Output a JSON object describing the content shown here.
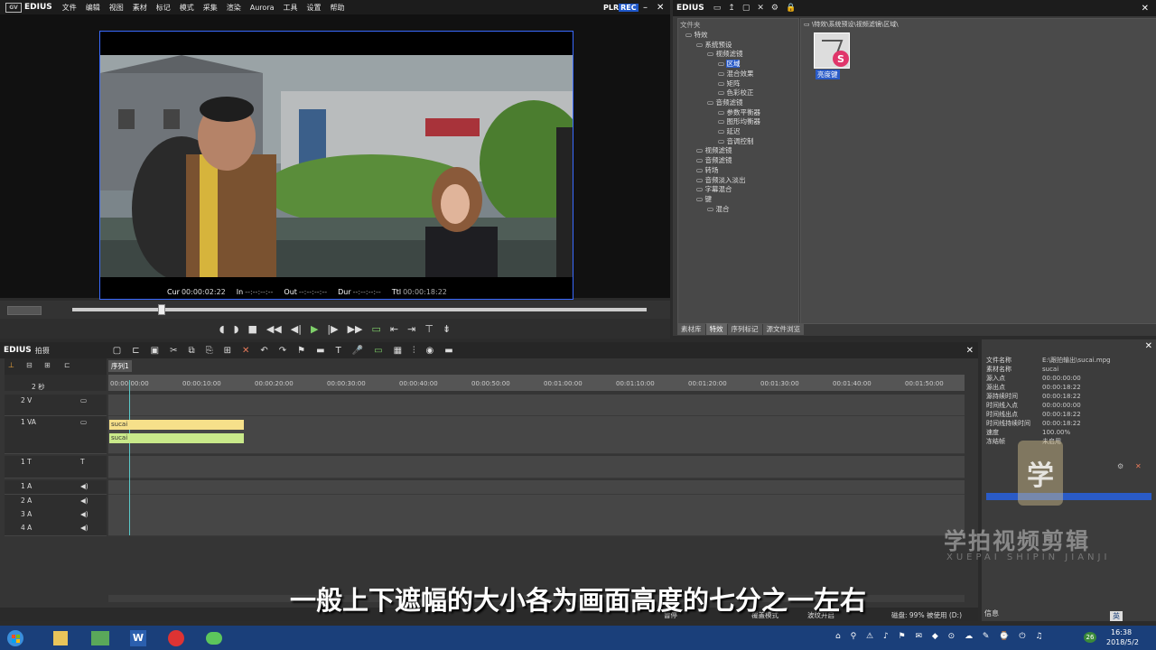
{
  "app": {
    "name": "EDIUS",
    "menus": [
      "文件",
      "编辑",
      "视图",
      "素材",
      "标记",
      "模式",
      "采集",
      "渲染",
      "Aurora",
      "工具",
      "设置",
      "帮助"
    ],
    "plr": "PLR",
    "rec": "REC"
  },
  "preview": {
    "cur_label": "Cur",
    "cur_value": "00:00:02:22",
    "in_label": "In",
    "in_value": "--:--:--:--",
    "out_label": "Out",
    "out_value": "--:--:--:--",
    "dur_label": "Dur",
    "dur_value": "--:--:--:--",
    "ttl_label": "Ttl",
    "ttl_value": "00:00:18:22"
  },
  "effects_panel": {
    "title": "EDIUS",
    "tree_header": "文件夹",
    "path": "\\特效\\系统预设\\视频滤镜\\区域\\",
    "tree": [
      {
        "label": "特效",
        "level": 0
      },
      {
        "label": "系统预设",
        "level": 1
      },
      {
        "label": "视频滤镜",
        "level": 2
      },
      {
        "label": "区域",
        "level": 3,
        "selected": true
      },
      {
        "label": "混合效果",
        "level": 3
      },
      {
        "label": "矩阵",
        "level": 3
      },
      {
        "label": "色彩校正",
        "level": 3
      },
      {
        "label": "音频滤镜",
        "level": 2
      },
      {
        "label": "参数平衡器",
        "level": 3
      },
      {
        "label": "图形均衡器",
        "level": 3
      },
      {
        "label": "延迟",
        "level": 3
      },
      {
        "label": "音调控制",
        "level": 3
      },
      {
        "label": "视频滤镜",
        "level": 1
      },
      {
        "label": "音频滤镜",
        "level": 1
      },
      {
        "label": "转场",
        "level": 1
      },
      {
        "label": "音频淡入淡出",
        "level": 1
      },
      {
        "label": "字幕混合",
        "level": 1
      },
      {
        "label": "键",
        "level": 1
      },
      {
        "label": "混合",
        "level": 2
      }
    ],
    "thumb_label": "亮度键",
    "tabs": [
      "素材库",
      "特效",
      "序列标记",
      "源文件浏览"
    ],
    "active_tab": "特效"
  },
  "timeline": {
    "title": "EDIUS",
    "project": "拍摄",
    "sequence_tab": "序列1",
    "zoom_label": "2 秒",
    "ruler_labels": [
      "00:00:00:00",
      "00:00:10:00",
      "00:00:20:00",
      "00:00:30:00",
      "00:00:40:00",
      "00:00:50:00",
      "00:01:00:00",
      "00:01:10:00",
      "00:01:20:00",
      "00:01:30:00",
      "00:01:40:00",
      "00:01:50:00"
    ],
    "tracks": [
      {
        "name": "2 V",
        "type": "video"
      },
      {
        "name": "1 VA",
        "type": "videoaudio"
      },
      {
        "name": "1 T",
        "type": "title"
      },
      {
        "name": "1 A",
        "type": "audio"
      },
      {
        "name": "2 A",
        "type": "audio"
      },
      {
        "name": "3 A",
        "type": "audio"
      },
      {
        "name": "4 A",
        "type": "audio"
      }
    ],
    "clip_video": "sucai",
    "clip_audio": "sucai"
  },
  "info_panel": {
    "rows": [
      {
        "k": "文件名称",
        "v": "E:\\跟拍输出\\sucai.mpg"
      },
      {
        "k": "素材名称",
        "v": "sucai"
      },
      {
        "k": "源入点",
        "v": "00:00:00:00"
      },
      {
        "k": "源出点",
        "v": "00:00:18:22"
      },
      {
        "k": "源持续时间",
        "v": "00:00:18:22"
      },
      {
        "k": "时间线入点",
        "v": "00:00:00:00"
      },
      {
        "k": "时间线出点",
        "v": "00:00:18:22"
      },
      {
        "k": "时间线持续时间",
        "v": "00:00:18:22"
      },
      {
        "k": "速度",
        "v": "100.00%"
      },
      {
        "k": "冻结帧",
        "v": "未启用"
      }
    ],
    "footer": "信息"
  },
  "status": {
    "pause": "暂停",
    "overwrite": "覆盖模式",
    "ripple": "波纹开启",
    "disk": "磁盘: 99% 被使用 (D:)"
  },
  "subtitle": "一般上下遮幅的大小各为画面高度的七分之一左右",
  "watermark": {
    "title": "学拍视频剪辑",
    "sub": "XUEPAI SHIPIN JIANJI",
    "logo_char": "学"
  },
  "taskbar": {
    "time": "16:38",
    "date": "2018/5/2",
    "ime": "英",
    "battery": "26"
  },
  "colors": {
    "accent": "#3a6aff",
    "clip_video": "#f6e08a",
    "clip_audio": "#c9e98a",
    "taskbar": "#1a3f7a"
  }
}
